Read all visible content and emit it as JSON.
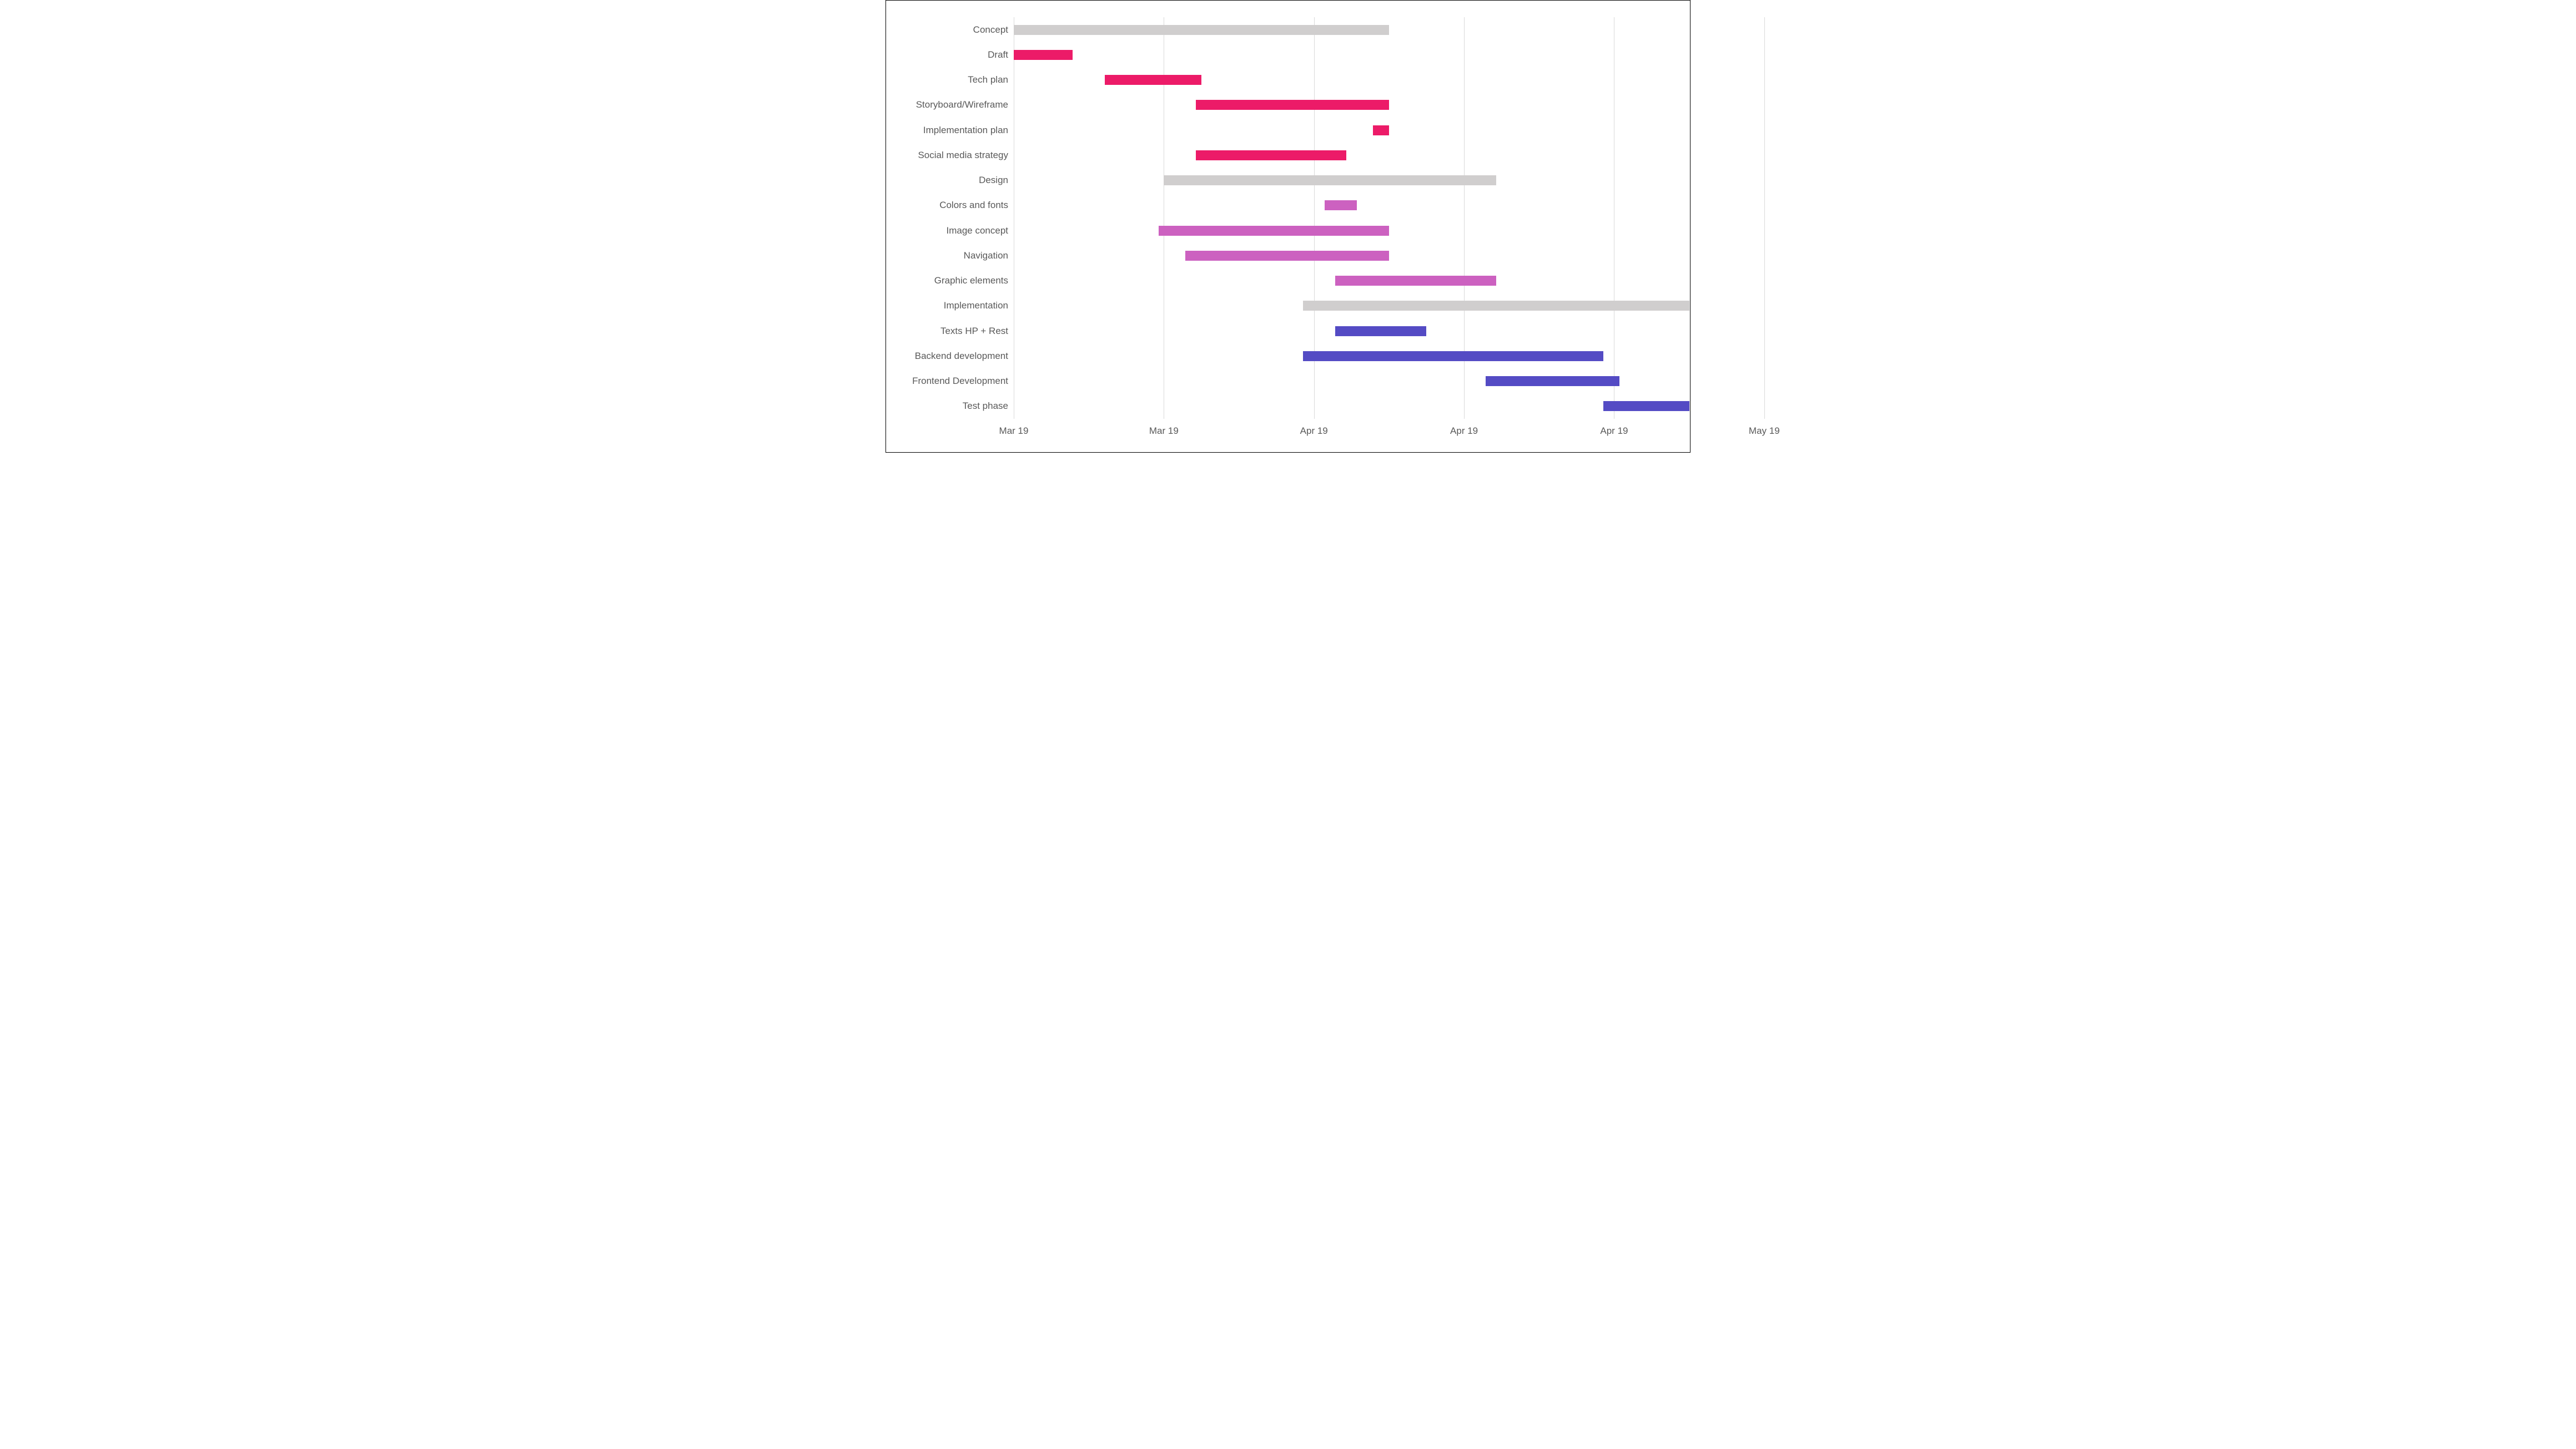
{
  "chart_data": {
    "type": "gantt",
    "title": "",
    "xlabel": "",
    "ylabel": "",
    "x_axis": {
      "min": 0,
      "max": 61,
      "ticks": [
        {
          "value": 0,
          "label": "Mar 19"
        },
        {
          "value": 14,
          "label": "Mar 19"
        },
        {
          "value": 28,
          "label": "Apr 19"
        },
        {
          "value": 42,
          "label": "Apr 19"
        },
        {
          "value": 56,
          "label": "Apr 19"
        },
        {
          "value": 70,
          "label": "May 19"
        }
      ]
    },
    "colors": {
      "summary": "#d0cece",
      "concept": "#ec1b68",
      "design": "#cc61c0",
      "impl": "#544bc4"
    },
    "tasks": [
      {
        "name": "Concept",
        "start": 0,
        "end": 35,
        "color": "summary"
      },
      {
        "name": "Draft",
        "start": 0,
        "end": 5.5,
        "color": "concept"
      },
      {
        "name": "Tech plan",
        "start": 8.5,
        "end": 17.5,
        "color": "concept"
      },
      {
        "name": "Storyboard/Wireframe",
        "start": 17,
        "end": 35,
        "color": "concept"
      },
      {
        "name": "Implementation plan",
        "start": 33.5,
        "end": 35,
        "color": "concept"
      },
      {
        "name": "Social media strategy",
        "start": 17,
        "end": 31,
        "color": "concept"
      },
      {
        "name": "Design",
        "start": 14,
        "end": 45,
        "color": "summary"
      },
      {
        "name": "Colors and fonts",
        "start": 29,
        "end": 32,
        "color": "design"
      },
      {
        "name": "Image concept",
        "start": 13.5,
        "end": 35,
        "color": "design"
      },
      {
        "name": "Navigation",
        "start": 16,
        "end": 35,
        "color": "design"
      },
      {
        "name": "Graphic elements",
        "start": 30,
        "end": 45,
        "color": "design"
      },
      {
        "name": "Implementation",
        "start": 27,
        "end": 63,
        "color": "summary"
      },
      {
        "name": "Texts HP + Rest",
        "start": 30,
        "end": 38.5,
        "color": "impl"
      },
      {
        "name": "Backend development",
        "start": 27,
        "end": 55,
        "color": "impl"
      },
      {
        "name": "Frontend Development",
        "start": 44,
        "end": 56.5,
        "color": "impl"
      },
      {
        "name": "Test phase",
        "start": 55,
        "end": 63,
        "color": "impl"
      }
    ]
  }
}
